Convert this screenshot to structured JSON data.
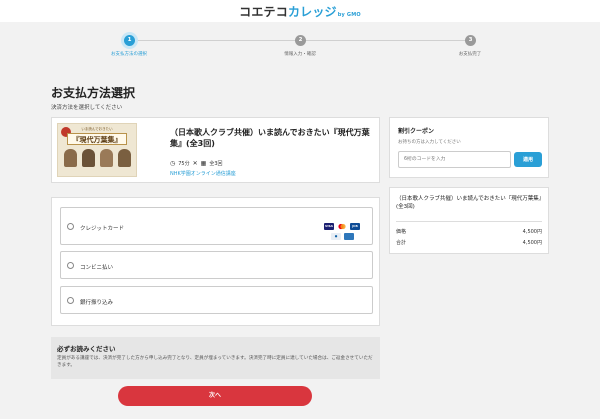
{
  "logo": {
    "part1": "コエテコ",
    "part2": "カレッジ",
    "part3": "by GMO"
  },
  "steps": [
    {
      "num": "1",
      "label": "お支払方法の選択"
    },
    {
      "num": "2",
      "label": "情報入力・確認"
    },
    {
      "num": "3",
      "label": "お支払完了"
    }
  ],
  "page": {
    "title": "お支払方法選択",
    "subtitle": "決済方法を選択してください"
  },
  "course": {
    "thumb_caption": "いま読んでおきたい",
    "thumb_title": "『現代万葉集』",
    "title": "（日本歌人クラブ共催）いま読んでおきたい『現代万葉集』(全3回)",
    "duration": "75分",
    "sessions": "全3回",
    "organizer": "NHK学園オンライン通信講座"
  },
  "payment": {
    "options": [
      {
        "label": "クレジットカード"
      },
      {
        "label": "コンビニ払い"
      },
      {
        "label": "銀行振り込み"
      }
    ],
    "card_brands": [
      "VISA",
      "MC",
      "JCB",
      "DINERS",
      "AMEX"
    ]
  },
  "notice": {
    "title": "必ずお読みください",
    "body": "定員がある講座では、決済が完了した方から申し込み完了となり、定員が埋まっていきます。決済完了時に定員に達していた場合は、ご返金させていただきます。"
  },
  "next_button": "次へ",
  "coupon": {
    "title": "割引クーポン",
    "hint": "お持ちの方は入力してください",
    "placeholder": "6桁のコードを入力",
    "apply": "適用"
  },
  "summary": {
    "title": "（日本歌人クラブ共催）いま読んでおきたい『現代万葉集』(全3回)",
    "price_label": "価格",
    "price_value": "4,500円",
    "total_label": "合計",
    "total_value": "4,500円"
  },
  "colors": {
    "accent": "#2a9fd6",
    "next_button": "#d9363e"
  }
}
